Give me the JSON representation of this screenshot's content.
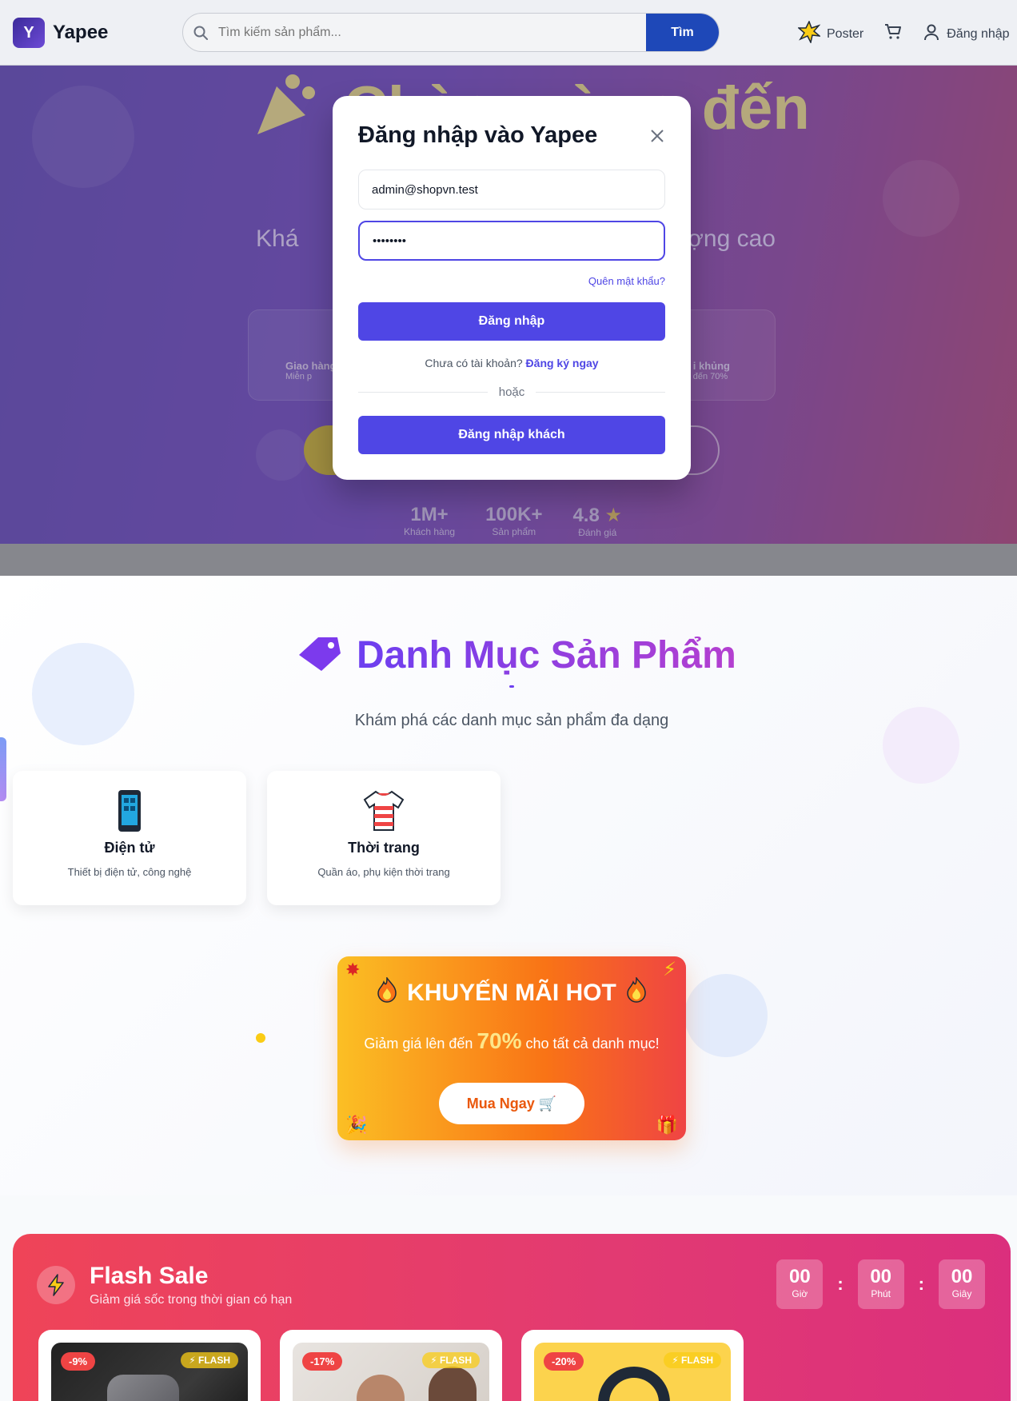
{
  "header": {
    "logo_letter": "Y",
    "brand": "Yapee",
    "search_placeholder": "Tìm kiếm sản phẩm...",
    "search_button": "Tìm",
    "poster_label": "Poster",
    "login_label": "Đăng nhập"
  },
  "hero": {
    "title": "Chào mừng đến",
    "subtitle_left": "Khá",
    "subtitle_right": "ợng cao",
    "feature_left_title": "Giao hàng",
    "feature_left_sub": "Miễn p",
    "feature_right_title": "i khủng",
    "feature_right_sub": "đến 70%",
    "stats": [
      {
        "value": "1M+",
        "label": "Khách hàng"
      },
      {
        "value": "100K+",
        "label": "Sản phẩm"
      },
      {
        "value": "4.8",
        "label": "Đánh giá"
      }
    ]
  },
  "modal": {
    "title": "Đăng nhập vào Yapee",
    "email_value": "admin@shopvn.test",
    "password_value": "••••••••",
    "forgot": "Quên mật khẩu?",
    "login_button": "Đăng nhập",
    "no_account": "Chưa có tài khoản?",
    "signup_link": "Đăng ký ngay",
    "or": "hoặc",
    "guest_button": "Đăng nhập khách"
  },
  "categories": {
    "title": "Danh Mục Sản Phẩm",
    "subtitle": "Khám phá các danh mục sản phẩm đa dạng",
    "items": [
      {
        "name": "Điện tử",
        "desc": "Thiết bị điện tử, công nghệ",
        "icon": "phone-icon"
      },
      {
        "name": "Thời trang",
        "desc": "Quần áo, phụ kiện thời trang",
        "icon": "shirt-icon"
      }
    ]
  },
  "promo": {
    "title": "KHUYẾN MÃI HOT",
    "text_before": "Giảm giá lên đến",
    "percent": "70%",
    "text_after": "cho tất cả danh mục!",
    "button": "Mua Ngay"
  },
  "flash_sale": {
    "title": "Flash Sale",
    "subtitle": "Giảm giá sốc trong thời gian có hạn",
    "timer": [
      {
        "value": "00",
        "label": "Giờ"
      },
      {
        "value": "00",
        "label": "Phút"
      },
      {
        "value": "00",
        "label": "Giây"
      }
    ],
    "products": [
      {
        "discount": "-9%",
        "tag": "FLASH"
      },
      {
        "discount": "-17%",
        "tag": "FLASH"
      },
      {
        "discount": "-20%",
        "tag": "FLASH"
      }
    ]
  },
  "colors": {
    "accent": "#4f46e5",
    "brand_blue": "#1e48b8",
    "flash_red": "#ef4458",
    "promo_orange": "#f97316"
  }
}
